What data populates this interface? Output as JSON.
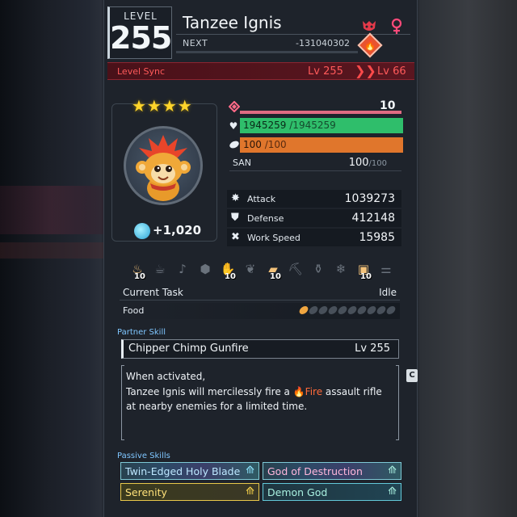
{
  "header": {
    "level_caption": "LEVEL",
    "level": "255",
    "pal_name": "Tanzee Ignis",
    "next_label": "NEXT",
    "next_value": "-131040302",
    "gender": "female",
    "element": "fire"
  },
  "level_sync": {
    "label": "Level Sync",
    "from": "Lv 255",
    "arrow": "❯❯",
    "to": "Lv 66"
  },
  "portrait": {
    "stars": "★★★★",
    "trust_value": "+1,020"
  },
  "stats": {
    "rank": "10",
    "hp_current": "1945259",
    "hp_max": " /1945259",
    "food_current": "100",
    "food_max": " /100",
    "san_label": "SAN",
    "san_current": "100",
    "san_max": "/100",
    "attack_label": "Attack",
    "attack": "1039273",
    "defense_label": "Defense",
    "defense": "412148",
    "work_speed_label": "Work Speed",
    "work_speed": "15985"
  },
  "work": {
    "icons": [
      {
        "name": "kindling-icon",
        "level": "10",
        "active": true
      },
      {
        "name": "watering-icon",
        "level": "",
        "active": false
      },
      {
        "name": "planting-icon",
        "level": "",
        "active": false
      },
      {
        "name": "electricity-icon",
        "level": "",
        "active": false
      },
      {
        "name": "handiwork-icon",
        "level": "10",
        "active": true
      },
      {
        "name": "gathering-icon",
        "level": "",
        "active": false
      },
      {
        "name": "lumbering-icon",
        "level": "10",
        "active": true
      },
      {
        "name": "mining-icon",
        "level": "",
        "active": false
      },
      {
        "name": "medicine-icon",
        "level": "",
        "active": false
      },
      {
        "name": "cooling-icon",
        "level": "",
        "active": false
      },
      {
        "name": "transporting-icon",
        "level": "10",
        "active": true
      },
      {
        "name": "farming-icon",
        "level": "",
        "active": false
      }
    ],
    "current_task_label": "Current Task",
    "current_task": "Idle",
    "food_label": "Food",
    "food_pips_filled": 1,
    "food_pips_total": 10
  },
  "partner_skill": {
    "section_label": "Partner Skill",
    "name": "Chipper Chimp Gunfire",
    "level": "Lv  255",
    "line1": "When activated,",
    "line2a": "Tanzee Ignis will mercilessly fire a ",
    "fire_word": "Fire",
    "line2b": " assault rifle",
    "line3": "at nearby enemies for a limited time.",
    "side_tag": "C"
  },
  "passive_skills": {
    "section_label": "Passive Skills",
    "items": [
      {
        "name": "Twin-Edged Holy Blade",
        "color": "#bde7ff"
      },
      {
        "name": "God of Destruction",
        "color": "#ffb7dc"
      },
      {
        "name": "Serenity",
        "color": "#ffe27a"
      },
      {
        "name": "Demon God",
        "color": "#a8f0e0"
      }
    ]
  },
  "colors": {
    "hp": "#2fbe6b",
    "food": "#e0762c",
    "rank": "#e06b82",
    "sync": "#ff5a5a",
    "stars": "#ffd52b"
  }
}
